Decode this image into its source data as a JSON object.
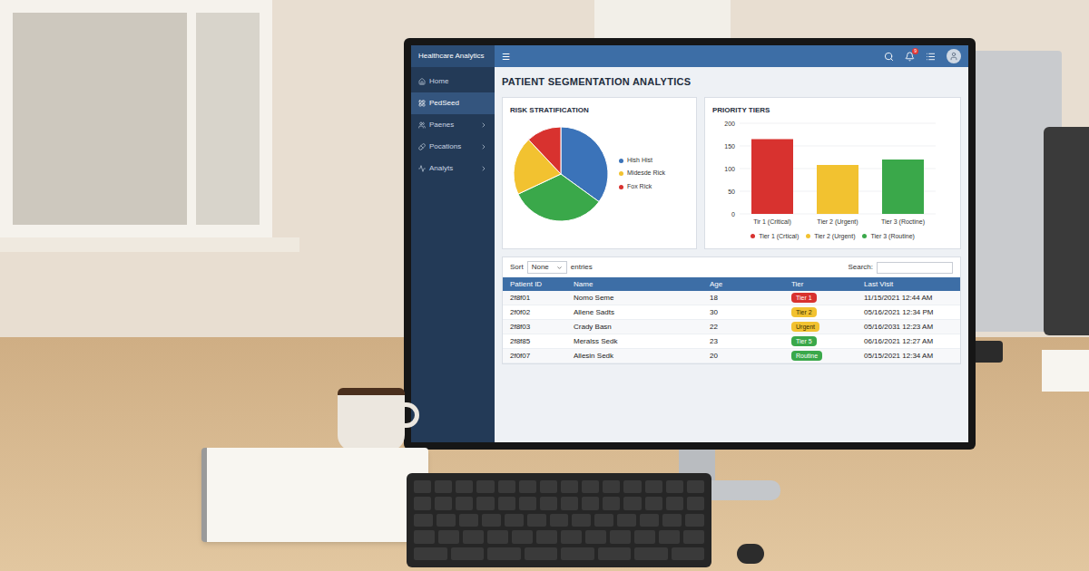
{
  "sidebar": {
    "title": "Healthcare Analytics",
    "items": [
      {
        "label": "Home",
        "selected": false,
        "expandable": false
      },
      {
        "label": "PedSeed",
        "selected": true,
        "expandable": false
      },
      {
        "label": "Paenes",
        "selected": false,
        "expandable": true
      },
      {
        "label": "Pocations",
        "selected": false,
        "expandable": true
      },
      {
        "label": "Analyts",
        "selected": false,
        "expandable": true
      }
    ]
  },
  "topbar": {
    "menu": "☰",
    "notifications": "9"
  },
  "page_title": "PATIENT SEGMENTATION ANALYTICS",
  "risk_chart": {
    "title": "RISK STRATIFICATION",
    "slices": [
      {
        "value": 35,
        "color": "#3b73b9"
      },
      {
        "value": 33,
        "color": "#3aa84a"
      },
      {
        "value": 20,
        "color": "#f2c230"
      },
      {
        "value": 12,
        "color": "#d8322f"
      }
    ],
    "legend": [
      {
        "label": "Hish Hist",
        "color": "#3b73b9"
      },
      {
        "label": "Midesde Rick",
        "color": "#f2c230"
      },
      {
        "label": "Fox Rick",
        "color": "#d8322f"
      }
    ]
  },
  "tiers_chart": {
    "title": "PRIORITY TIERS",
    "ticks": [
      "200",
      "150",
      "100",
      "50",
      "0"
    ],
    "bars": [
      {
        "label": "Tir 1 (Critical)",
        "value": 165,
        "color": "#d8322f"
      },
      {
        "label": "Tier 2 (Urgent)",
        "value": 108,
        "color": "#f2c230"
      },
      {
        "label": "Tier 3 (Roctine)",
        "value": 120,
        "color": "#3aa84a"
      }
    ],
    "legend": [
      {
        "label": "Tier 1 (Crtical)",
        "color": "#d8322f"
      },
      {
        "label": "Tier 2 (Urgent)",
        "color": "#f2c230"
      },
      {
        "label": "Tier 3 (Routine)",
        "color": "#3aa84a"
      }
    ]
  },
  "table_controls": {
    "sort_label": "Sort",
    "sort_value": "None",
    "entries_label": "entries",
    "search_label": "Search:"
  },
  "table": {
    "columns": [
      "Patient ID",
      "Name",
      "Age",
      "Tier",
      "Last Visit"
    ],
    "rows": [
      {
        "id": "2f8f01",
        "name": "Nomo Seme",
        "age": "18",
        "tier": "Tier 1",
        "tier_color": "#d8322f",
        "last_visit": "11/15/2021 12:44 AM"
      },
      {
        "id": "2f0f02",
        "name": "Allene Sadts",
        "age": "30",
        "tier": "Tier 2",
        "tier_color": "#f2c230",
        "last_visit": "05/16/2021 12:34 PM"
      },
      {
        "id": "2f8f03",
        "name": "Crady Basn",
        "age": "22",
        "tier": "Urgent",
        "tier_color": "#f2c230",
        "last_visit": "05/16/2031 12:23 AM"
      },
      {
        "id": "2f8f85",
        "name": "Meralss Sedk",
        "age": "23",
        "tier": "Tier 5",
        "tier_color": "#3aa84a",
        "last_visit": "06/16/2021 12:27 AM"
      },
      {
        "id": "2f0f07",
        "name": "Allesin Sedk",
        "age": "20",
        "tier": "Routine",
        "tier_color": "#3aa84a",
        "last_visit": "05/15/2021 12:34 AM"
      }
    ]
  }
}
